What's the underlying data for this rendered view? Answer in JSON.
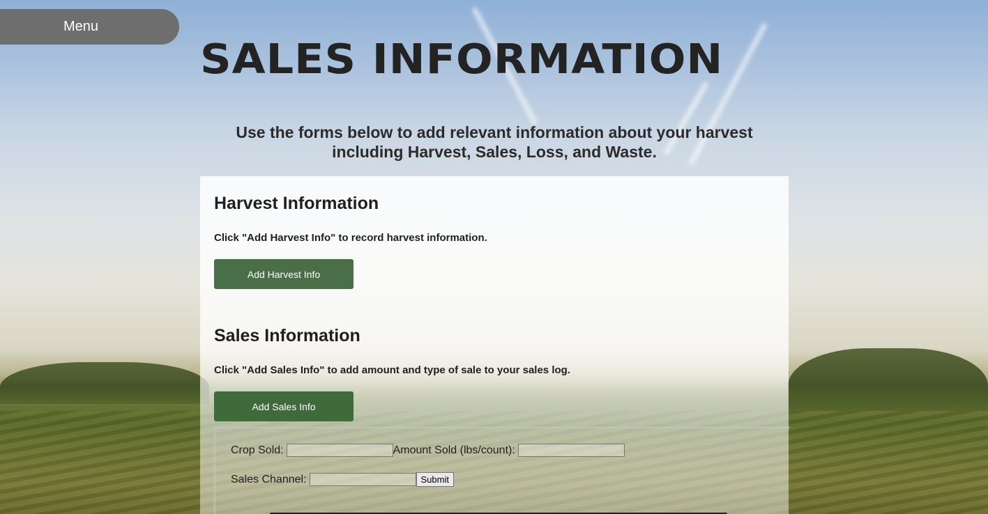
{
  "menu": {
    "label": "Menu"
  },
  "header": {
    "title": "Sales Information",
    "intro": "Use the forms below to add relevant information about your harvest including Harvest, Sales, Loss, and Waste."
  },
  "harvest": {
    "title": "Harvest Information",
    "description": "Click \"Add Harvest Info\" to record harvest information.",
    "button_label": "Add Harvest Info"
  },
  "sales": {
    "title": "Sales Information",
    "description": "Click \"Add Sales Info\" to add amount and type of sale to your sales log.",
    "button_label": "Add Sales Info",
    "form": {
      "crop_label": "Crop Sold:",
      "crop_value": "",
      "amount_label": "Amount Sold (lbs/count):",
      "amount_value": "",
      "channel_label": "Sales Channel:",
      "channel_value": "",
      "submit_label": "Submit"
    }
  },
  "colors": {
    "menu_bg": "#6e6e6e",
    "button_green": "#4a6e48",
    "title_text": "#232323"
  }
}
